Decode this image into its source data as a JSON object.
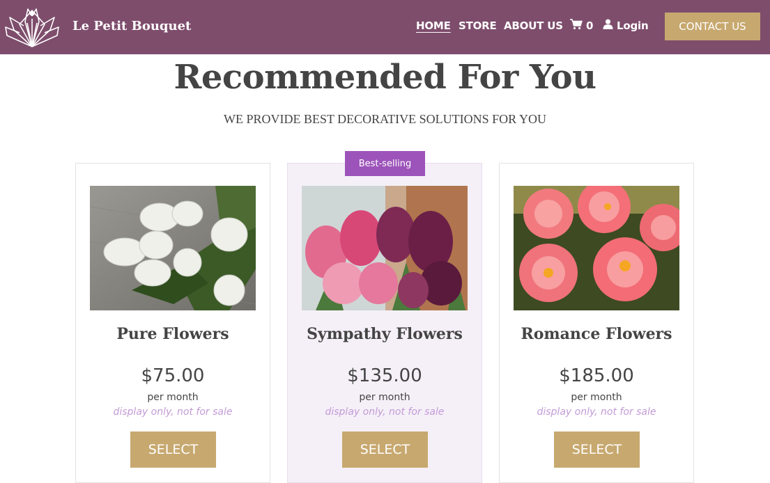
{
  "nav": {
    "brand": "Le Petit Bouquet",
    "links": [
      "HOME",
      "STORE",
      "ABOUT US"
    ],
    "cart_count": "0",
    "login": "Login",
    "contact": "CONTACT US",
    "icons": {
      "logo": "lotus-logo-icon",
      "cart": "shopping-cart-icon",
      "user": "user-icon"
    }
  },
  "section": {
    "title": "Recommended For You",
    "subtitle": "WE PROVIDE BEST DECORATIVE SOLUTIONS FOR YOU"
  },
  "badge": "Best-selling",
  "cards": [
    {
      "title": "Pure Flowers",
      "price": "$75.00",
      "period": "per month",
      "note": "display only, not for sale",
      "button": "SELECT",
      "image": "white-tulips-photo"
    },
    {
      "title": "Sympathy Flowers",
      "price": "$135.00",
      "period": "per month",
      "note": "display only, not for sale",
      "button": "SELECT",
      "image": "pink-purple-tulips-photo"
    },
    {
      "title": "Romance Flowers",
      "price": "$185.00",
      "period": "per month",
      "note": "display only, not for sale",
      "button": "SELECT",
      "image": "coral-peonies-photo"
    }
  ],
  "colors": {
    "nav_bg": "#7e4d6c",
    "accent_gold": "#c7a86f",
    "badge_purple": "#9d54ba",
    "note_lavender": "#c39ad6",
    "featured_bg": "#f5f0f8"
  }
}
